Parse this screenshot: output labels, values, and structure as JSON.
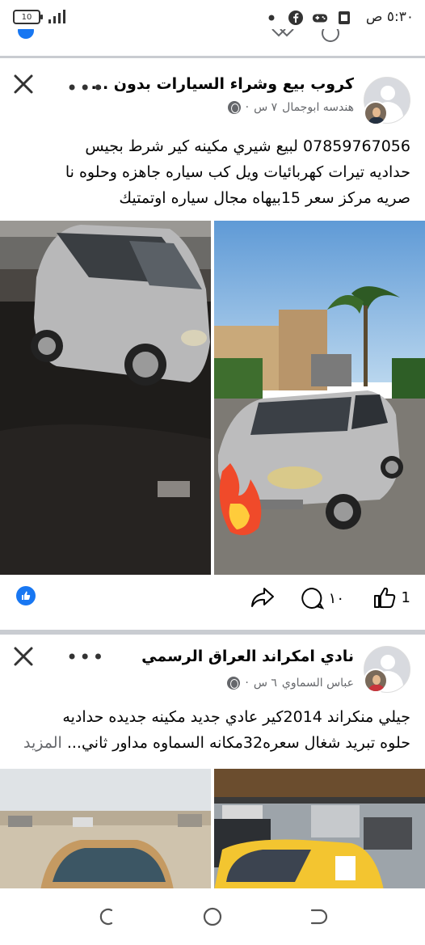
{
  "status_bar": {
    "time": "٥:٣٠ ص",
    "battery": "10",
    "icons": [
      "dot-icon",
      "facebook-icon",
      "gamepad-icon",
      "sim-icon"
    ]
  },
  "posts": [
    {
      "group_name": "كروب بيع وشراء السيارات بدون ...",
      "author": "هندسه ابوجمال",
      "time": "٧ س",
      "text_lines": [
        "07859767056 لبيع شيري مكينه كير شرط بجيس",
        "حداديه تيرات كهربائيات ويل كب سياره جاهزه وحلوه نا",
        "صريه مركز سعر 15بيهاه مجال سياره اوتمتيك"
      ],
      "likes": "1",
      "comments": "١٠"
    },
    {
      "group_name": "نادي امكراند العراق الرسمي",
      "author": "عباس السماوي",
      "time": "٦ س",
      "text_lines": [
        "جيلي منكراند 2014كير عادي جديد مكينه جديده حداديه",
        "حلوه تبريد شغال سعره32مكانه السماوه مداور ثاني..."
      ],
      "more_label": "المزيد"
    }
  ],
  "colors": {
    "accent": "#1877f2",
    "muted": "#65676b",
    "divider": "#c9ccd1"
  }
}
